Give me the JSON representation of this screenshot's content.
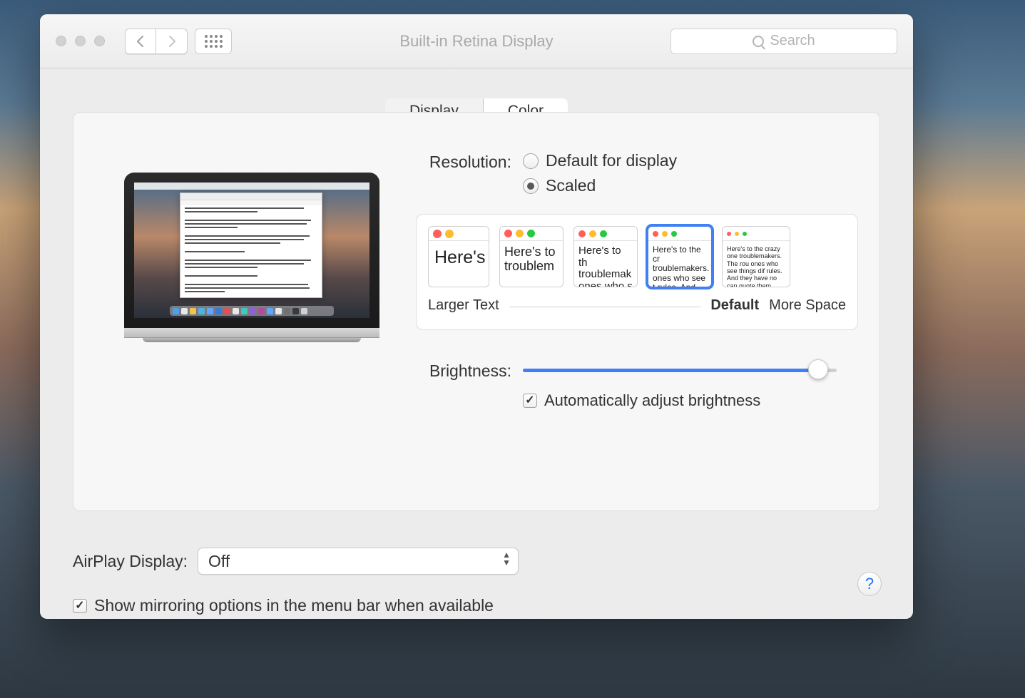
{
  "window": {
    "title": "Built-in Retina Display"
  },
  "search": {
    "placeholder": "Search"
  },
  "tabs": {
    "display": "Display",
    "color": "Color",
    "active": "color"
  },
  "resolution": {
    "label": "Resolution:",
    "default_option": "Default for display",
    "scaled_option": "Scaled",
    "selected": "scaled",
    "scale_left_label": "Larger Text",
    "scale_default_label": "Default",
    "scale_right_label": "More Space",
    "thumbs": {
      "t0": "Here's",
      "t1": "Here's to troublem",
      "t2": "Here's to th troublemak ones who s",
      "t3": "Here's to the cr troublemakers. ones who see t rules. And they",
      "t4": "Here's to the crazy one troublemakers. The rou ones who see things dif rules. And they have no can quote them, disagr them. About the only thi Because they change th"
    }
  },
  "brightness": {
    "label": "Brightness:",
    "value_pct": 94,
    "auto_label": "Automatically adjust brightness",
    "auto_checked": true
  },
  "airplay": {
    "label": "AirPlay Display:",
    "value": "Off"
  },
  "mirror": {
    "label": "Show mirroring options in the menu bar when available",
    "checked": true
  },
  "help": {
    "glyph": "?"
  }
}
